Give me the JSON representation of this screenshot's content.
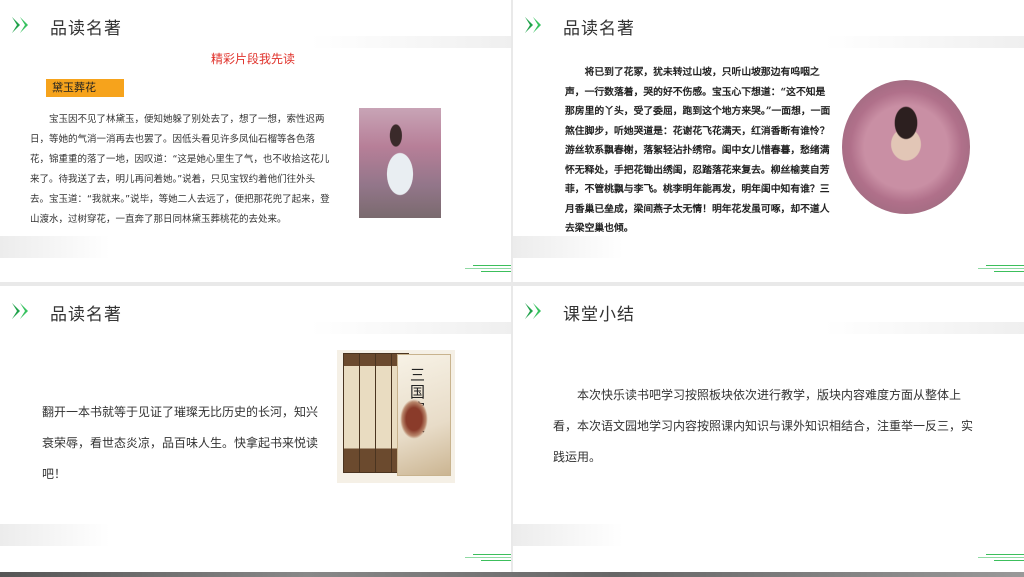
{
  "slides": [
    {
      "title": "品读名著",
      "subtitle": "精彩片段我先读",
      "tag": "黛玉葬花",
      "paragraph": "宝玉因不见了林黛玉，便知她躲了别处去了，想了一想，索性迟两日，等她的气消一消再去也罢了。因低头看见许多凤仙石榴等各色落花，锦重重的落了一地，因叹道：“这是她心里生了气，也不收拾这花儿来了。待我送了去，明儿再问着她。”说着，只见宝钗约着他们往外头去。宝玉道：“我就来。”说毕，等她二人去远了，便把那花兜了起来，登山渡水，过树穿花，一直奔了那日同林黛玉葬桃花的去处来。"
    },
    {
      "title": "品读名著",
      "paragraph": "将已到了花冢，犹未转过山坡，只听山坡那边有呜咽之声，一行数落着，哭的好不伤感。宝玉心下想道：“这不知是那房里的丫头，受了委屈，跑到这个地方来哭。”一面想，一面煞住脚步，听她哭道是：花谢花飞花满天，红消香断有谁怜？游丝软系飘春榭，落絮轻沾扑绣帘。闺中女儿惜春暮，愁绪满怀无释处，手把花锄出绣闺，忍踏落花来复去。柳丝榆荚自芳菲，不管桃飘与李飞。桃李明年能再发，明年闺中知有谁？三月香巢已垒成，梁间燕子太无情！明年花发虽可啄，却不道人去梁空巢也倾。"
    },
    {
      "title": "品读名著",
      "paragraph": "翻开一本书就等于见证了璀璨无比历史的长河，知兴衰荣辱，看世态炎凉，品百味人生。快拿起书来悦读吧！",
      "cover_title": "三国演义"
    },
    {
      "title": "课堂小结",
      "paragraph": "本次快乐读书吧学习按照板块依次进行教学，版块内容难度方面从整体上看，本次语文园地学习内容按照课内知识与课外知识相结合，注重举一反三，实践运用。"
    }
  ],
  "colors": {
    "accent_green": "#1fa24a",
    "subtitle_red": "#e0322b",
    "tag_orange": "#f6a31c"
  },
  "icons": [
    "double-chevron-icon"
  ]
}
